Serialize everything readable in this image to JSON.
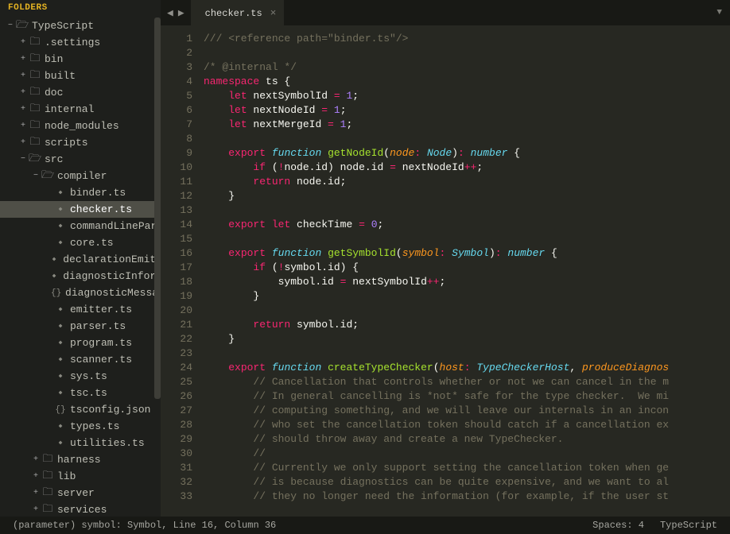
{
  "sidebar": {
    "header": "FOLDERS",
    "tree": [
      {
        "depth": 0,
        "arrow": "down",
        "icon": "dir-open",
        "label": "TypeScript"
      },
      {
        "depth": 1,
        "arrow": "right",
        "icon": "dir",
        "label": ".settings"
      },
      {
        "depth": 1,
        "arrow": "right",
        "icon": "dir",
        "label": "bin"
      },
      {
        "depth": 1,
        "arrow": "right",
        "icon": "dir",
        "label": "built"
      },
      {
        "depth": 1,
        "arrow": "right",
        "icon": "dir",
        "label": "doc"
      },
      {
        "depth": 1,
        "arrow": "right",
        "icon": "dir",
        "label": "internal"
      },
      {
        "depth": 1,
        "arrow": "right",
        "icon": "dir",
        "label": "node_modules"
      },
      {
        "depth": 1,
        "arrow": "right",
        "icon": "dir",
        "label": "scripts"
      },
      {
        "depth": 1,
        "arrow": "down",
        "icon": "dir-open",
        "label": "src"
      },
      {
        "depth": 2,
        "arrow": "down",
        "icon": "dir-open",
        "label": "compiler"
      },
      {
        "depth": 3,
        "arrow": "none",
        "icon": "ts",
        "label": "binder.ts"
      },
      {
        "depth": 3,
        "arrow": "none",
        "icon": "ts",
        "label": "checker.ts",
        "active": true
      },
      {
        "depth": 3,
        "arrow": "none",
        "icon": "ts",
        "label": "commandLinePar"
      },
      {
        "depth": 3,
        "arrow": "none",
        "icon": "ts",
        "label": "core.ts"
      },
      {
        "depth": 3,
        "arrow": "none",
        "icon": "ts",
        "label": "declarationEmitte"
      },
      {
        "depth": 3,
        "arrow": "none",
        "icon": "ts",
        "label": "diagnosticInforma"
      },
      {
        "depth": 3,
        "arrow": "none",
        "icon": "json",
        "label": "diagnosticMessag"
      },
      {
        "depth": 3,
        "arrow": "none",
        "icon": "ts",
        "label": "emitter.ts"
      },
      {
        "depth": 3,
        "arrow": "none",
        "icon": "ts",
        "label": "parser.ts"
      },
      {
        "depth": 3,
        "arrow": "none",
        "icon": "ts",
        "label": "program.ts"
      },
      {
        "depth": 3,
        "arrow": "none",
        "icon": "ts",
        "label": "scanner.ts"
      },
      {
        "depth": 3,
        "arrow": "none",
        "icon": "ts",
        "label": "sys.ts"
      },
      {
        "depth": 3,
        "arrow": "none",
        "icon": "ts",
        "label": "tsc.ts"
      },
      {
        "depth": 3,
        "arrow": "none",
        "icon": "json",
        "label": "tsconfig.json"
      },
      {
        "depth": 3,
        "arrow": "none",
        "icon": "ts",
        "label": "types.ts"
      },
      {
        "depth": 3,
        "arrow": "none",
        "icon": "ts",
        "label": "utilities.ts"
      },
      {
        "depth": 2,
        "arrow": "right",
        "icon": "dir",
        "label": "harness"
      },
      {
        "depth": 2,
        "arrow": "right",
        "icon": "dir",
        "label": "lib"
      },
      {
        "depth": 2,
        "arrow": "right",
        "icon": "dir",
        "label": "server"
      },
      {
        "depth": 2,
        "arrow": "right",
        "icon": "dir",
        "label": "services"
      }
    ]
  },
  "tabs": {
    "active": {
      "label": "checker.ts"
    }
  },
  "editor": {
    "first_line": 1,
    "lines": [
      [
        [
          "cm",
          "/// <reference path=\"binder.ts\"/>"
        ]
      ],
      [],
      [
        [
          "cm",
          "/* @internal */"
        ]
      ],
      [
        [
          "kw",
          "namespace"
        ],
        [
          "pl",
          " ts {"
        ]
      ],
      [
        [
          "pl",
          "    "
        ],
        [
          "kw",
          "let"
        ],
        [
          "pl",
          " nextSymbolId "
        ],
        [
          "op",
          "="
        ],
        [
          "pl",
          " "
        ],
        [
          "nm",
          "1"
        ],
        [
          "pl",
          ";"
        ]
      ],
      [
        [
          "pl",
          "    "
        ],
        [
          "kw",
          "let"
        ],
        [
          "pl",
          " nextNodeId "
        ],
        [
          "op",
          "="
        ],
        [
          "pl",
          " "
        ],
        [
          "nm",
          "1"
        ],
        [
          "pl",
          ";"
        ]
      ],
      [
        [
          "pl",
          "    "
        ],
        [
          "kw",
          "let"
        ],
        [
          "pl",
          " nextMergeId "
        ],
        [
          "op",
          "="
        ],
        [
          "pl",
          " "
        ],
        [
          "nm",
          "1"
        ],
        [
          "pl",
          ";"
        ]
      ],
      [],
      [
        [
          "pl",
          "    "
        ],
        [
          "kw",
          "export"
        ],
        [
          "pl",
          " "
        ],
        [
          "st",
          "function"
        ],
        [
          "pl",
          " "
        ],
        [
          "fn",
          "getNodeId"
        ],
        [
          "pl",
          "("
        ],
        [
          "pr",
          "node"
        ],
        [
          "op",
          ":"
        ],
        [
          "pl",
          " "
        ],
        [
          "st",
          "Node"
        ],
        [
          "pl",
          ")"
        ],
        [
          "op",
          ":"
        ],
        [
          "pl",
          " "
        ],
        [
          "st",
          "number"
        ],
        [
          "pl",
          " {"
        ]
      ],
      [
        [
          "pl",
          "        "
        ],
        [
          "kw",
          "if"
        ],
        [
          "pl",
          " ("
        ],
        [
          "op",
          "!"
        ],
        [
          "pl",
          "node.id) node.id "
        ],
        [
          "op",
          "="
        ],
        [
          "pl",
          " nextNodeId"
        ],
        [
          "op",
          "++"
        ],
        [
          "pl",
          ";"
        ]
      ],
      [
        [
          "pl",
          "        "
        ],
        [
          "kw",
          "return"
        ],
        [
          "pl",
          " node.id;"
        ]
      ],
      [
        [
          "pl",
          "    }"
        ]
      ],
      [],
      [
        [
          "pl",
          "    "
        ],
        [
          "kw",
          "export"
        ],
        [
          "pl",
          " "
        ],
        [
          "kw",
          "let"
        ],
        [
          "pl",
          " checkTime "
        ],
        [
          "op",
          "="
        ],
        [
          "pl",
          " "
        ],
        [
          "nm",
          "0"
        ],
        [
          "pl",
          ";"
        ]
      ],
      [],
      [
        [
          "pl",
          "    "
        ],
        [
          "kw",
          "export"
        ],
        [
          "pl",
          " "
        ],
        [
          "st",
          "function"
        ],
        [
          "pl",
          " "
        ],
        [
          "fn",
          "getSymbolId"
        ],
        [
          "pl",
          "("
        ],
        [
          "pr",
          "symbol"
        ],
        [
          "op",
          ":"
        ],
        [
          "pl",
          " "
        ],
        [
          "st",
          "Symbol"
        ],
        [
          "pl",
          ")"
        ],
        [
          "op",
          ":"
        ],
        [
          "pl",
          " "
        ],
        [
          "st",
          "number"
        ],
        [
          "pl",
          " {"
        ]
      ],
      [
        [
          "pl",
          "        "
        ],
        [
          "kw",
          "if"
        ],
        [
          "pl",
          " ("
        ],
        [
          "op",
          "!"
        ],
        [
          "pl",
          "symbol.id) {"
        ]
      ],
      [
        [
          "pl",
          "            symbol.id "
        ],
        [
          "op",
          "="
        ],
        [
          "pl",
          " nextSymbolId"
        ],
        [
          "op",
          "++"
        ],
        [
          "pl",
          ";"
        ]
      ],
      [
        [
          "pl",
          "        }"
        ]
      ],
      [],
      [
        [
          "pl",
          "        "
        ],
        [
          "kw",
          "return"
        ],
        [
          "pl",
          " symbol.id;"
        ]
      ],
      [
        [
          "pl",
          "    }"
        ]
      ],
      [],
      [
        [
          "pl",
          "    "
        ],
        [
          "kw",
          "export"
        ],
        [
          "pl",
          " "
        ],
        [
          "st",
          "function"
        ],
        [
          "pl",
          " "
        ],
        [
          "fn",
          "createTypeChecker"
        ],
        [
          "pl",
          "("
        ],
        [
          "pr",
          "host"
        ],
        [
          "op",
          ":"
        ],
        [
          "pl",
          " "
        ],
        [
          "st",
          "TypeCheckerHost"
        ],
        [
          "pl",
          ", "
        ],
        [
          "pr",
          "produceDiagnos"
        ]
      ],
      [
        [
          "pl",
          "        "
        ],
        [
          "cm",
          "// Cancellation that controls whether or not we can cancel in the m"
        ]
      ],
      [
        [
          "pl",
          "        "
        ],
        [
          "cm",
          "// In general cancelling is *not* safe for the type checker.  We mi"
        ]
      ],
      [
        [
          "pl",
          "        "
        ],
        [
          "cm",
          "// computing something, and we will leave our internals in an incon"
        ]
      ],
      [
        [
          "pl",
          "        "
        ],
        [
          "cm",
          "// who set the cancellation token should catch if a cancellation ex"
        ]
      ],
      [
        [
          "pl",
          "        "
        ],
        [
          "cm",
          "// should throw away and create a new TypeChecker."
        ]
      ],
      [
        [
          "pl",
          "        "
        ],
        [
          "cm",
          "//"
        ]
      ],
      [
        [
          "pl",
          "        "
        ],
        [
          "cm",
          "// Currently we only support setting the cancellation token when ge"
        ]
      ],
      [
        [
          "pl",
          "        "
        ],
        [
          "cm",
          "// is because diagnostics can be quite expensive, and we want to al"
        ]
      ],
      [
        [
          "pl",
          "        "
        ],
        [
          "cm",
          "// they no longer need the information (for example, if the user st"
        ]
      ]
    ]
  },
  "status": {
    "left": "(parameter) symbol: Symbol, Line 16, Column 36",
    "spaces": "Spaces: 4",
    "lang": "TypeScript"
  }
}
